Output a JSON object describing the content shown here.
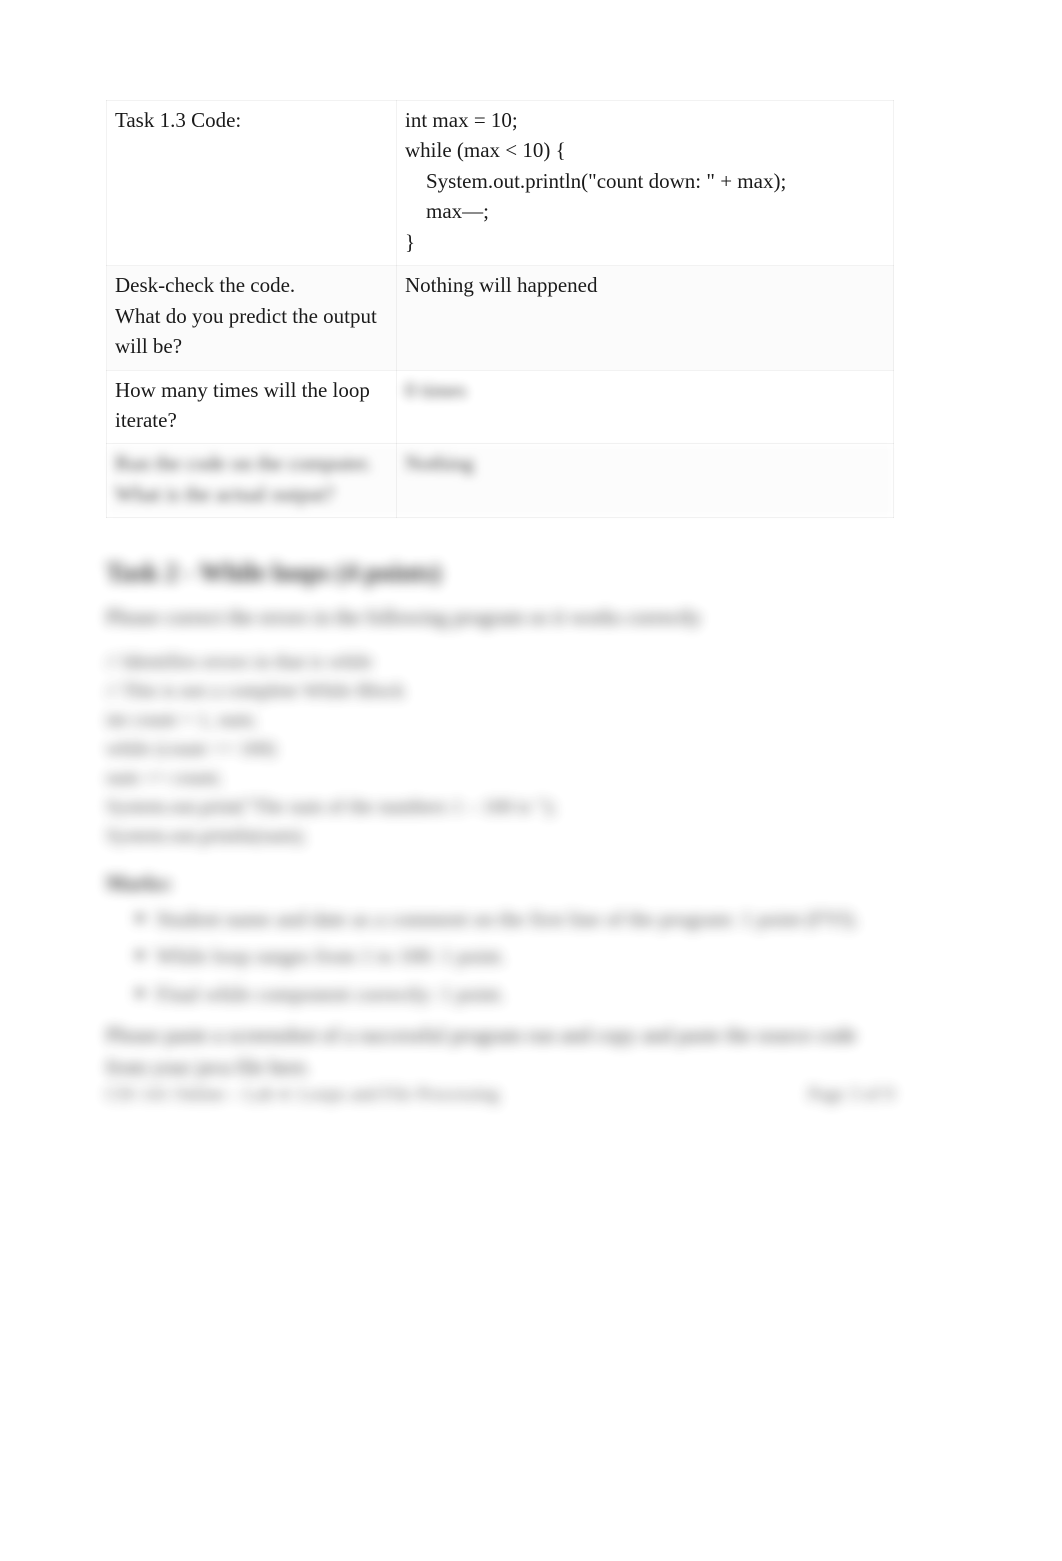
{
  "table": {
    "row1": {
      "label": "Task 1.3 Code:",
      "code_lines": [
        "int max = 10;",
        "while (max < 10) {",
        "    System.out.println(\"count down: \" + max);",
        "    max—;",
        "}"
      ]
    },
    "row2": {
      "label_line1": "Desk-check the code.",
      "label_line2": "What do you predict the output will be?",
      "answer": "Nothing will happened"
    },
    "row3": {
      "label": "How many times will the loop iterate?",
      "answer": "0 times"
    },
    "row4": {
      "label_line1": "Run the code on the computer.",
      "label_line2": "What is the actual output?",
      "answer": "Nothing"
    }
  },
  "task2": {
    "heading": "Task 2 - While loops (4 points)",
    "intro": "Please correct the errors in the following program so it works correctly",
    "code_lines": [
      "// Identifies errors in that is while",
      "// This is not a complete While Block",
      "int count = 1, sum;",
      "while (count <= 100)",
      "sum += count;",
      "System.out.print(\"The sum of the numbers 1 – 100 is \");",
      "System.out.println(sum);"
    ],
    "marks_heading": "Marks:",
    "marks_items": [
      "Student name and date as a comment on the first line of the program: 1 point (FYI).",
      "While loop ranges from 1 to 100: 1 point.",
      "Final while component correctly: 1 point."
    ],
    "closing": "Please paste a screenshot of a successful program run and copy and paste the source code from your java file here."
  },
  "footer": {
    "left": "CIS 141 Online – Lab 4: Loops and File Processing",
    "right": "Page 3 of 9"
  }
}
